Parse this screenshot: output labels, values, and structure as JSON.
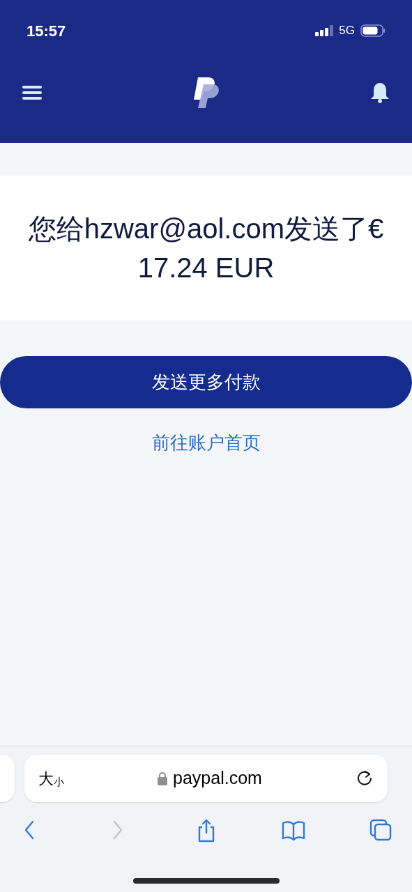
{
  "status_bar": {
    "time": "15:57",
    "network": "5G"
  },
  "message": {
    "heading": "您给hzwar@aol.com发送了€ 17.24 EUR"
  },
  "primary_button": {
    "label": "发送更多付款"
  },
  "link": {
    "label": "前往账户首页"
  },
  "browser": {
    "text_size": {
      "large": "大",
      "small": "小"
    },
    "url": "paypal.com",
    "nav": [
      {
        "kind": "back",
        "disabled": false
      },
      {
        "kind": "forward",
        "disabled": true
      },
      {
        "kind": "share",
        "disabled": false
      },
      {
        "kind": "bookmarks",
        "disabled": false
      },
      {
        "kind": "tabs",
        "disabled": false
      }
    ]
  }
}
